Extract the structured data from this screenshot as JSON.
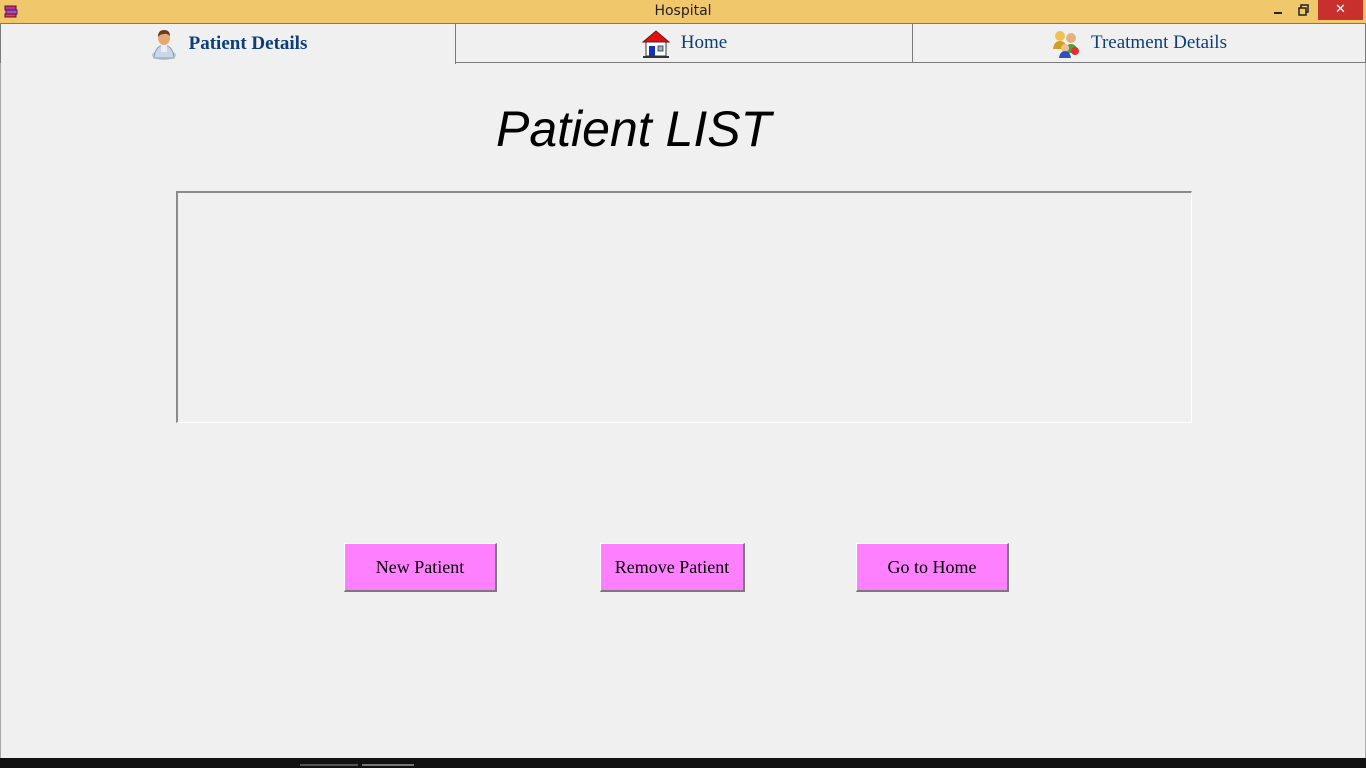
{
  "window": {
    "title": "Hospital",
    "app_icon": "books-icon",
    "controls": {
      "minimize": "minimize",
      "maximize": "maximize",
      "close": "✕"
    }
  },
  "tabs": [
    {
      "label": "Patient Details",
      "icon": "patient-icon",
      "active": true
    },
    {
      "label": "Home",
      "icon": "house-icon",
      "active": false
    },
    {
      "label": "Treatment Details",
      "icon": "people-group-icon",
      "active": false
    }
  ],
  "main": {
    "title": "Patient LIST",
    "patient_list_items": []
  },
  "buttons": {
    "new_patient": "New Patient",
    "remove_patient": "Remove Patient",
    "go_home": "Go to Home"
  },
  "colors": {
    "titlebar": "#f0c76b",
    "tab_text": "#0e3d78",
    "button_bg": "#ff80ff",
    "close_button": "#c7302c",
    "background": "#f0f0f0"
  }
}
